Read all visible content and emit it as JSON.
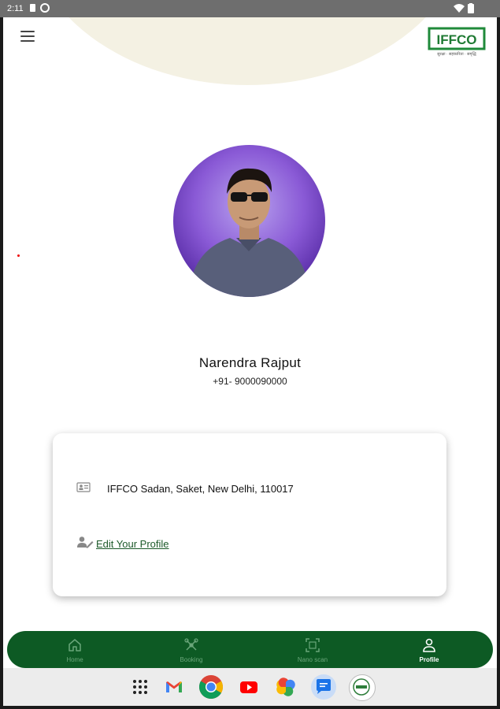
{
  "status_bar": {
    "time": "2:11"
  },
  "header": {
    "logo_text": "IFFCO",
    "logo_tagline": "सुरक्षा · सहकारिता · समृद्धि"
  },
  "profile": {
    "name": "Narendra Rajput",
    "phone": "+91- 9000090000",
    "address": "IFFCO Sadan, Saket, New Delhi, 110017",
    "edit_label": " Edit Your Profile"
  },
  "bottom_nav": {
    "items": [
      {
        "label": "Home",
        "icon": "home-icon",
        "active": false
      },
      {
        "label": "Booking",
        "icon": "drone-icon",
        "active": false
      },
      {
        "label": "Nano scan",
        "icon": "scan-icon",
        "active": false
      },
      {
        "label": "Profile",
        "icon": "person-icon",
        "active": true
      }
    ]
  },
  "dock": {
    "apps": [
      "app-drawer",
      "gmail",
      "chrome",
      "youtube",
      "photos",
      "messages",
      "app"
    ]
  },
  "colors": {
    "brand_green": "#0d5a24",
    "nav_inactive": "#6aa67a",
    "link_green": "#1d5a2a",
    "arc": "#f4f1e3"
  }
}
